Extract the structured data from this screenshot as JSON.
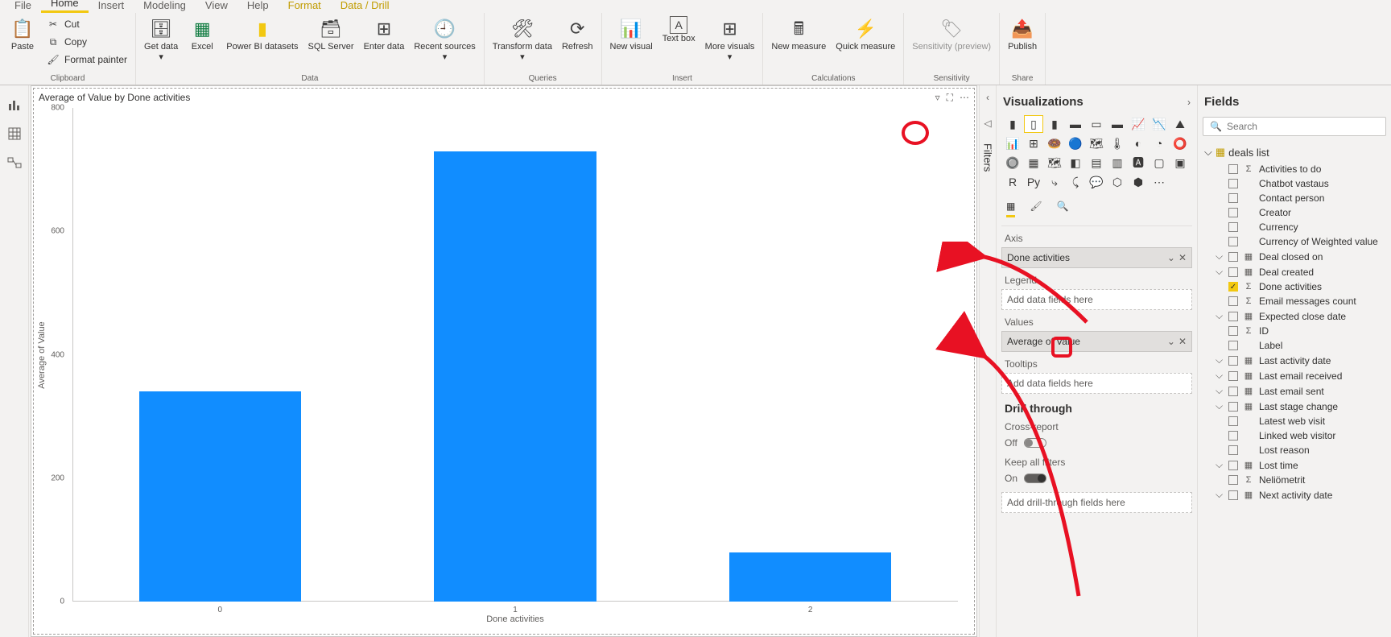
{
  "menu": {
    "file": "File",
    "home": "Home",
    "insert": "Insert",
    "modeling": "Modeling",
    "view": "View",
    "help": "Help",
    "format": "Format",
    "datadrill": "Data / Drill"
  },
  "ribbon": {
    "clipboard": {
      "label": "Clipboard",
      "paste": "Paste",
      "cut": "Cut",
      "copy": "Copy",
      "format_painter": "Format painter"
    },
    "data": {
      "label": "Data",
      "get_data": "Get data",
      "excel": "Excel",
      "pbi_datasets": "Power BI datasets",
      "sql": "SQL Server",
      "enter_data": "Enter data",
      "recent": "Recent sources"
    },
    "queries": {
      "label": "Queries",
      "transform": "Transform data",
      "refresh": "Refresh"
    },
    "insert": {
      "label": "Insert",
      "new_visual": "New visual",
      "text_box": "Text box",
      "more_visuals": "More visuals"
    },
    "calculations": {
      "label": "Calculations",
      "new_measure": "New measure",
      "quick_measure": "Quick measure"
    },
    "sensitivity": {
      "label": "Sensitivity",
      "btn": "Sensitivity (preview)"
    },
    "share": {
      "label": "Share",
      "publish": "Publish"
    }
  },
  "chart_data": {
    "type": "bar",
    "title": "Average of Value by Done activities",
    "xlabel": "Done activities",
    "ylabel": "Average of Value",
    "categories": [
      "0",
      "1",
      "2"
    ],
    "values": [
      340,
      730,
      80
    ],
    "ylim": [
      0,
      800
    ],
    "yticks": [
      0,
      200,
      400,
      600,
      800
    ]
  },
  "filters": {
    "label": "Filters"
  },
  "viz": {
    "title": "Visualizations",
    "wells": {
      "axis_label": "Axis",
      "axis_value": "Done activities",
      "legend_label": "Legend",
      "legend_placeholder": "Add data fields here",
      "values_label": "Values",
      "values_value": "Average of Value",
      "tooltips_label": "Tooltips",
      "tooltips_placeholder": "Add data fields here"
    },
    "drill": {
      "title": "Drill through",
      "cross": "Cross-report",
      "off": "Off",
      "keep": "Keep all filters",
      "on": "On",
      "placeholder": "Add drill-through fields here"
    }
  },
  "fields": {
    "title": "Fields",
    "search_placeholder": "Search",
    "table": "deals list",
    "items": [
      {
        "name": "Activities to do",
        "checked": false,
        "expandable": false,
        "type": "sum"
      },
      {
        "name": "Chatbot vastaus",
        "checked": false,
        "expandable": false,
        "type": ""
      },
      {
        "name": "Contact person",
        "checked": false,
        "expandable": false,
        "type": ""
      },
      {
        "name": "Creator",
        "checked": false,
        "expandable": false,
        "type": ""
      },
      {
        "name": "Currency",
        "checked": false,
        "expandable": false,
        "type": ""
      },
      {
        "name": "Currency of Weighted value",
        "checked": false,
        "expandable": false,
        "type": ""
      },
      {
        "name": "Deal closed on",
        "checked": false,
        "expandable": true,
        "type": "date"
      },
      {
        "name": "Deal created",
        "checked": false,
        "expandable": true,
        "type": "date"
      },
      {
        "name": "Done activities",
        "checked": true,
        "expandable": false,
        "type": "sum"
      },
      {
        "name": "Email messages count",
        "checked": false,
        "expandable": false,
        "type": "sum"
      },
      {
        "name": "Expected close date",
        "checked": false,
        "expandable": true,
        "type": "date"
      },
      {
        "name": "ID",
        "checked": false,
        "expandable": false,
        "type": "sum"
      },
      {
        "name": "Label",
        "checked": false,
        "expandable": false,
        "type": ""
      },
      {
        "name": "Last activity date",
        "checked": false,
        "expandable": true,
        "type": "date"
      },
      {
        "name": "Last email received",
        "checked": false,
        "expandable": true,
        "type": "date"
      },
      {
        "name": "Last email sent",
        "checked": false,
        "expandable": true,
        "type": "date"
      },
      {
        "name": "Last stage change",
        "checked": false,
        "expandable": true,
        "type": "date"
      },
      {
        "name": "Latest web visit",
        "checked": false,
        "expandable": false,
        "type": ""
      },
      {
        "name": "Linked web visitor",
        "checked": false,
        "expandable": false,
        "type": ""
      },
      {
        "name": "Lost reason",
        "checked": false,
        "expandable": false,
        "type": ""
      },
      {
        "name": "Lost time",
        "checked": false,
        "expandable": true,
        "type": "date"
      },
      {
        "name": "Neliömetrit",
        "checked": false,
        "expandable": false,
        "type": "sum"
      },
      {
        "name": "Next activity date",
        "checked": false,
        "expandable": true,
        "type": "date"
      }
    ]
  }
}
